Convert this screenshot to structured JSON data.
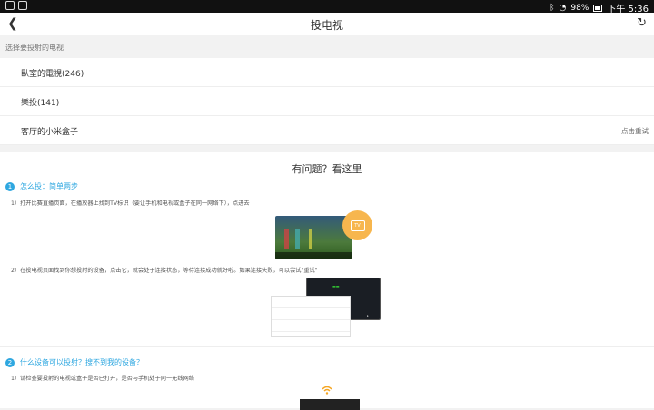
{
  "statusbar": {
    "battery": "98%",
    "time": "下午 5:36"
  },
  "header": {
    "title": "投电视"
  },
  "section_label": "选择要投射的电视",
  "devices": [
    {
      "name": "臥室的電視(246)",
      "action": ""
    },
    {
      "name": "樂投(141)",
      "action": ""
    },
    {
      "name": "客厅的小米盒子",
      "action": "点击重试"
    }
  ],
  "help": {
    "title": "有问题？看这里",
    "step1": {
      "num": "1",
      "heading": "怎么投：简单两步",
      "p1": "1）打开比赛直播页面，在播放器上找到TV标识（要让手机和电视或盒子在同一网络下），点进去",
      "p2": "2）在投电视页面找到你想投射的设备，点击它，就会处于连接状态，等待连接成功就好啦。如果连接失败，可以尝试\"重试\"",
      "tv_badge": "TV"
    },
    "step2": {
      "num": "2",
      "heading": "什么设备可以投射？搜不到我的设备？",
      "p1": "1）请检查要投射的电视或盒子是否已打开，是否与手机处于同一无线网络"
    }
  },
  "colors": {
    "accent": "#2ea7e0",
    "bubble": "#f7b64e"
  }
}
